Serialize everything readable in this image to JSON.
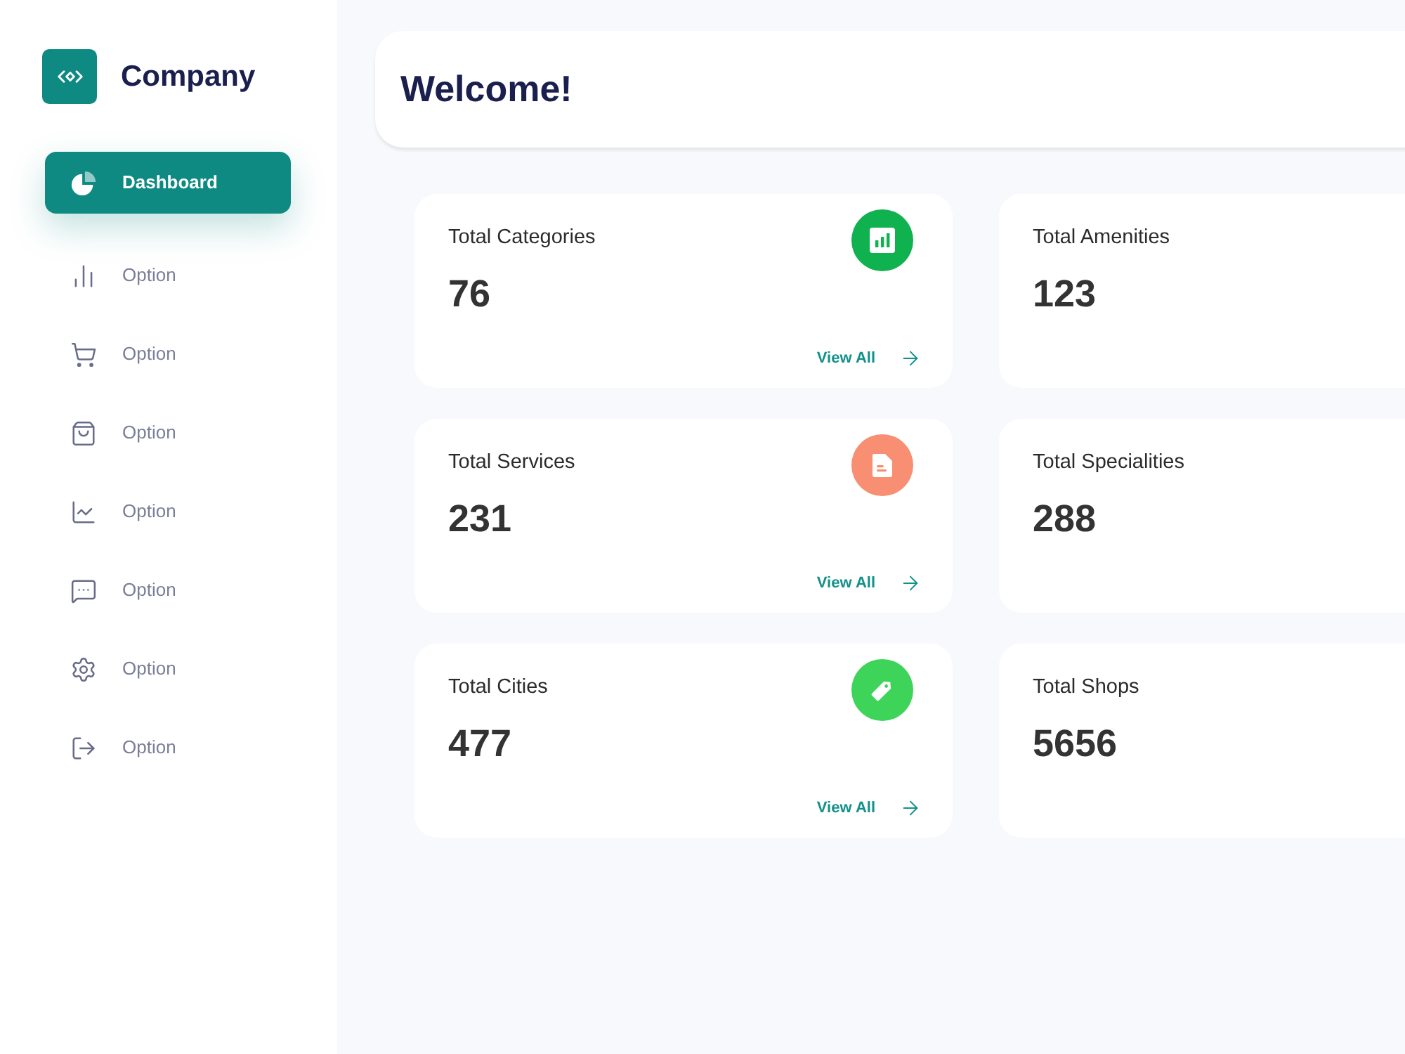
{
  "sidebar": {
    "brand": "Company",
    "items": [
      {
        "label": "Dashboard",
        "selected": true
      },
      {
        "label": "Option",
        "selected": false
      },
      {
        "label": "Option",
        "selected": false
      },
      {
        "label": "Option",
        "selected": false
      },
      {
        "label": "Option",
        "selected": false
      },
      {
        "label": "Option",
        "selected": false
      },
      {
        "label": "Option",
        "selected": false
      },
      {
        "label": "Option",
        "selected": false
      }
    ]
  },
  "header": {
    "title": "Welcome!"
  },
  "cards": [
    {
      "title": "Total Categories",
      "value": "76",
      "color": "#10b14f",
      "link": "View All"
    },
    {
      "title": "Total Amenities",
      "value": "123"
    },
    {
      "title": "Total Services",
      "value": "231",
      "color": "#f98f72",
      "link": "View All"
    },
    {
      "title": "Total Specialities",
      "value": "288"
    },
    {
      "title": "Total Cities",
      "value": "477",
      "color": "#3ed45a",
      "link": "View All"
    },
    {
      "title": "Total Shops",
      "value": "5656"
    }
  ]
}
